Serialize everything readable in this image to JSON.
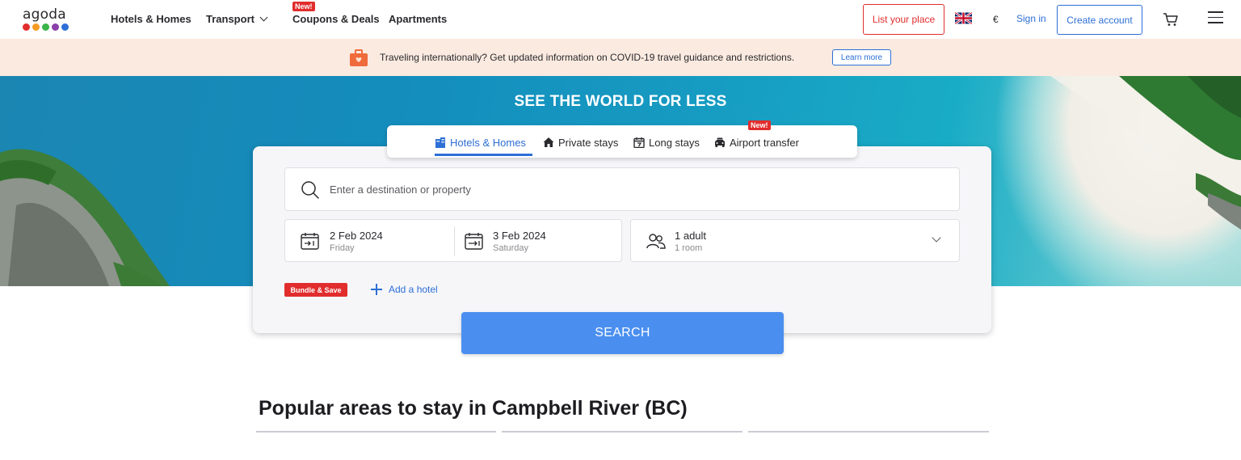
{
  "header": {
    "logo_text": "agoda",
    "logo_dot_colors": [
      "#e12d2d",
      "#f59b23",
      "#39b54a",
      "#8b3fa8",
      "#2d6fd6"
    ],
    "nav": [
      {
        "label": "Hotels & Homes"
      },
      {
        "label": "Transport",
        "icon": "chevron-down-icon"
      },
      {
        "label": "Coupons & Deals",
        "badge": "New!"
      },
      {
        "label": "Apartments"
      }
    ],
    "list_your_place": "List your place",
    "language_flag": "uk-flag-icon",
    "currency": "€",
    "sign_in": "Sign in",
    "create_account": "Create account",
    "cart_icon": "cart-icon",
    "menu_icon": "hamburger-menu-icon"
  },
  "banner": {
    "icon": "travel-bag-icon",
    "text": "Traveling internationally? Get updated information on COVID-19 travel guidance and restrictions.",
    "button": "Learn more"
  },
  "hero": {
    "title": "SEE THE WORLD FOR LESS"
  },
  "search": {
    "tabs": [
      {
        "label": "Hotels & Homes",
        "icon": "hotel-icon",
        "active": true
      },
      {
        "label": "Private stays",
        "icon": "house-icon"
      },
      {
        "label": "Long stays",
        "icon": "calendar-icon"
      },
      {
        "label": "Airport transfer",
        "icon": "car-icon",
        "badge": "New!"
      }
    ],
    "destination_placeholder": "Enter a destination or property",
    "check_in": {
      "date": "2 Feb 2024",
      "day": "Friday"
    },
    "check_out": {
      "date": "3 Feb 2024",
      "day": "Saturday"
    },
    "occupancy": {
      "main": "1 adult",
      "sub": "1 room"
    },
    "bundle_badge": "Bundle & Save",
    "add_hotel": "Add a hotel",
    "search_button": "SEARCH"
  },
  "popular": {
    "title": "Popular areas to stay in Campbell River (BC)"
  },
  "colors": {
    "brand_red": "#e12d2d",
    "link_blue": "#2d6fd6",
    "search_blue": "#4a8ff0",
    "banner_bg": "#fbeae0"
  }
}
